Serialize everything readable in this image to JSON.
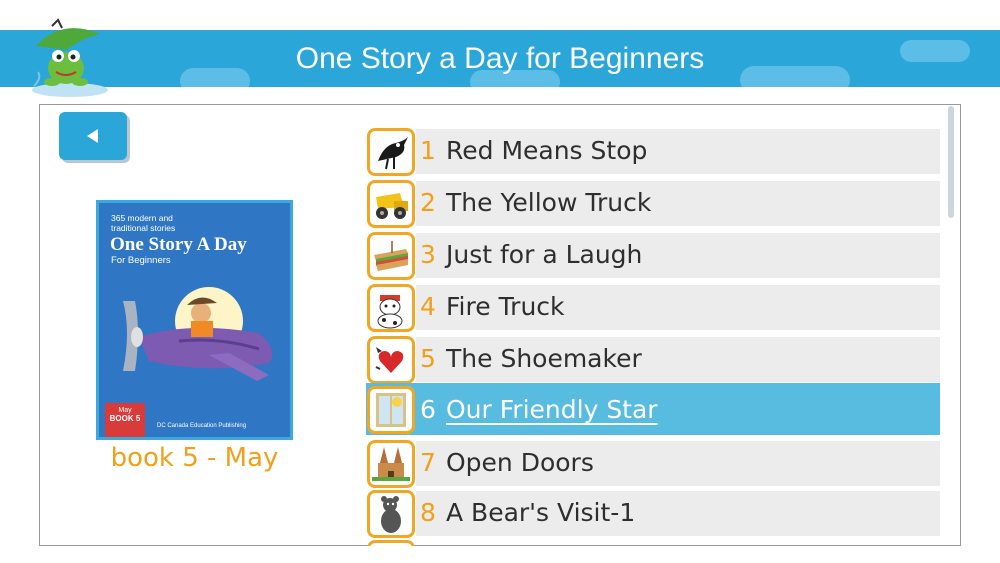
{
  "app": {
    "title": "One Story a Day for Beginners"
  },
  "nav": {
    "back_icon": "back-arrow-icon"
  },
  "book": {
    "cover": {
      "small_text": "365 modern and traditional stories",
      "title": "One Story A Day",
      "subtitle": "For Beginners",
      "badge_month": "May",
      "badge_book": "BOOK 5",
      "publisher": "DC Canada Education Publishing"
    },
    "label": "book 5 - May"
  },
  "stories": [
    {
      "number": "1",
      "title": "Red Means Stop",
      "icon": "crow-icon"
    },
    {
      "number": "2",
      "title": "The Yellow Truck",
      "icon": "yellow-truck-icon"
    },
    {
      "number": "3",
      "title": "Just for a Laugh",
      "icon": "sandwich-icon"
    },
    {
      "number": "4",
      "title": "Fire Truck",
      "icon": "dalmatian-icon"
    },
    {
      "number": "5",
      "title": "The Shoemaker",
      "icon": "heart-icon"
    },
    {
      "number": "6",
      "title": "Our Friendly Star",
      "icon": "window-sun-icon",
      "selected": true
    },
    {
      "number": "7",
      "title": "Open Doors",
      "icon": "church-icon"
    },
    {
      "number": "8",
      "title": "A Bear's Visit-1",
      "icon": "bear-icon"
    }
  ],
  "colors": {
    "header": "#2aa6d8",
    "accent": "#f2a019",
    "selected": "#58bce0",
    "row": "#ececec"
  }
}
